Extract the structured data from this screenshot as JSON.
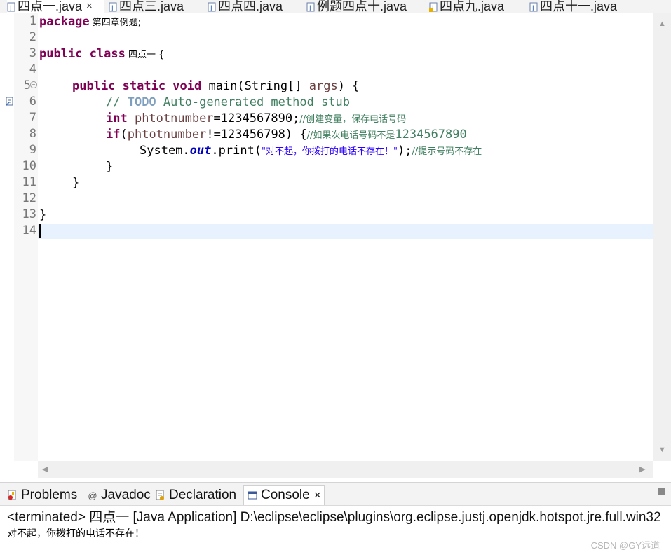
{
  "editor_tabs": [
    {
      "label": "四点一.java",
      "active": true,
      "close": "×"
    },
    {
      "label": "四点三.java"
    },
    {
      "label": "四点四.java"
    },
    {
      "label": "例题四点十.java"
    },
    {
      "label": "四点九.java"
    },
    {
      "label": "四点十一.java"
    }
  ],
  "line_numbers": [
    "1",
    "2",
    "3",
    "4",
    "5",
    "6",
    "7",
    "8",
    "9",
    "10",
    "11",
    "12",
    "13",
    "14"
  ],
  "code": {
    "l1": {
      "kw": "package",
      "name": " 第四章例题;"
    },
    "l3": {
      "kw": "public class",
      "name": " 四点一 {"
    },
    "l5": {
      "kw": "public static void",
      "rest1": " main(String[] ",
      "arg": "args",
      "rest2": ") {"
    },
    "l6": {
      "c1": "// ",
      "todo": "TODO",
      "c2": " Auto-generated method stub"
    },
    "l7": {
      "kw": "int",
      "var": " phtotnumber",
      "rest": "=1234567890;",
      "comment": "//创建变量，保存电话号码"
    },
    "l8": {
      "kw": "if",
      "rest1": "(",
      "var": "phtotnumber",
      "rest2": "!=123456798) {",
      "comment_zh": "//如果次电话号码不是",
      "comment_num": "1234567890"
    },
    "l9": {
      "rest1": "System.",
      "field": "out",
      "rest2": ".print(",
      "str": "\"对不起，你拨打的电话不存在！\"",
      "rest3": ");",
      "comment": "//提示号码不存在"
    },
    "l10": "}",
    "l11": "}",
    "l13": "}"
  },
  "views": {
    "tabs": [
      {
        "label": "Problems",
        "icon": "problems-icon"
      },
      {
        "label": "Javadoc",
        "icon": "@"
      },
      {
        "label": "Declaration",
        "icon": "declaration-icon"
      },
      {
        "label": "Console",
        "icon": "console-icon",
        "active": true,
        "close": "×"
      }
    ],
    "console_header": "<terminated> 四点一 [Java Application] D:\\eclipse\\eclipse\\plugins\\org.eclipse.justj.openjdk.hotspot.jre.full.win32",
    "console_output": "对不起，你拨打的电话不存在！"
  },
  "watermark": "CSDN @GY远道"
}
